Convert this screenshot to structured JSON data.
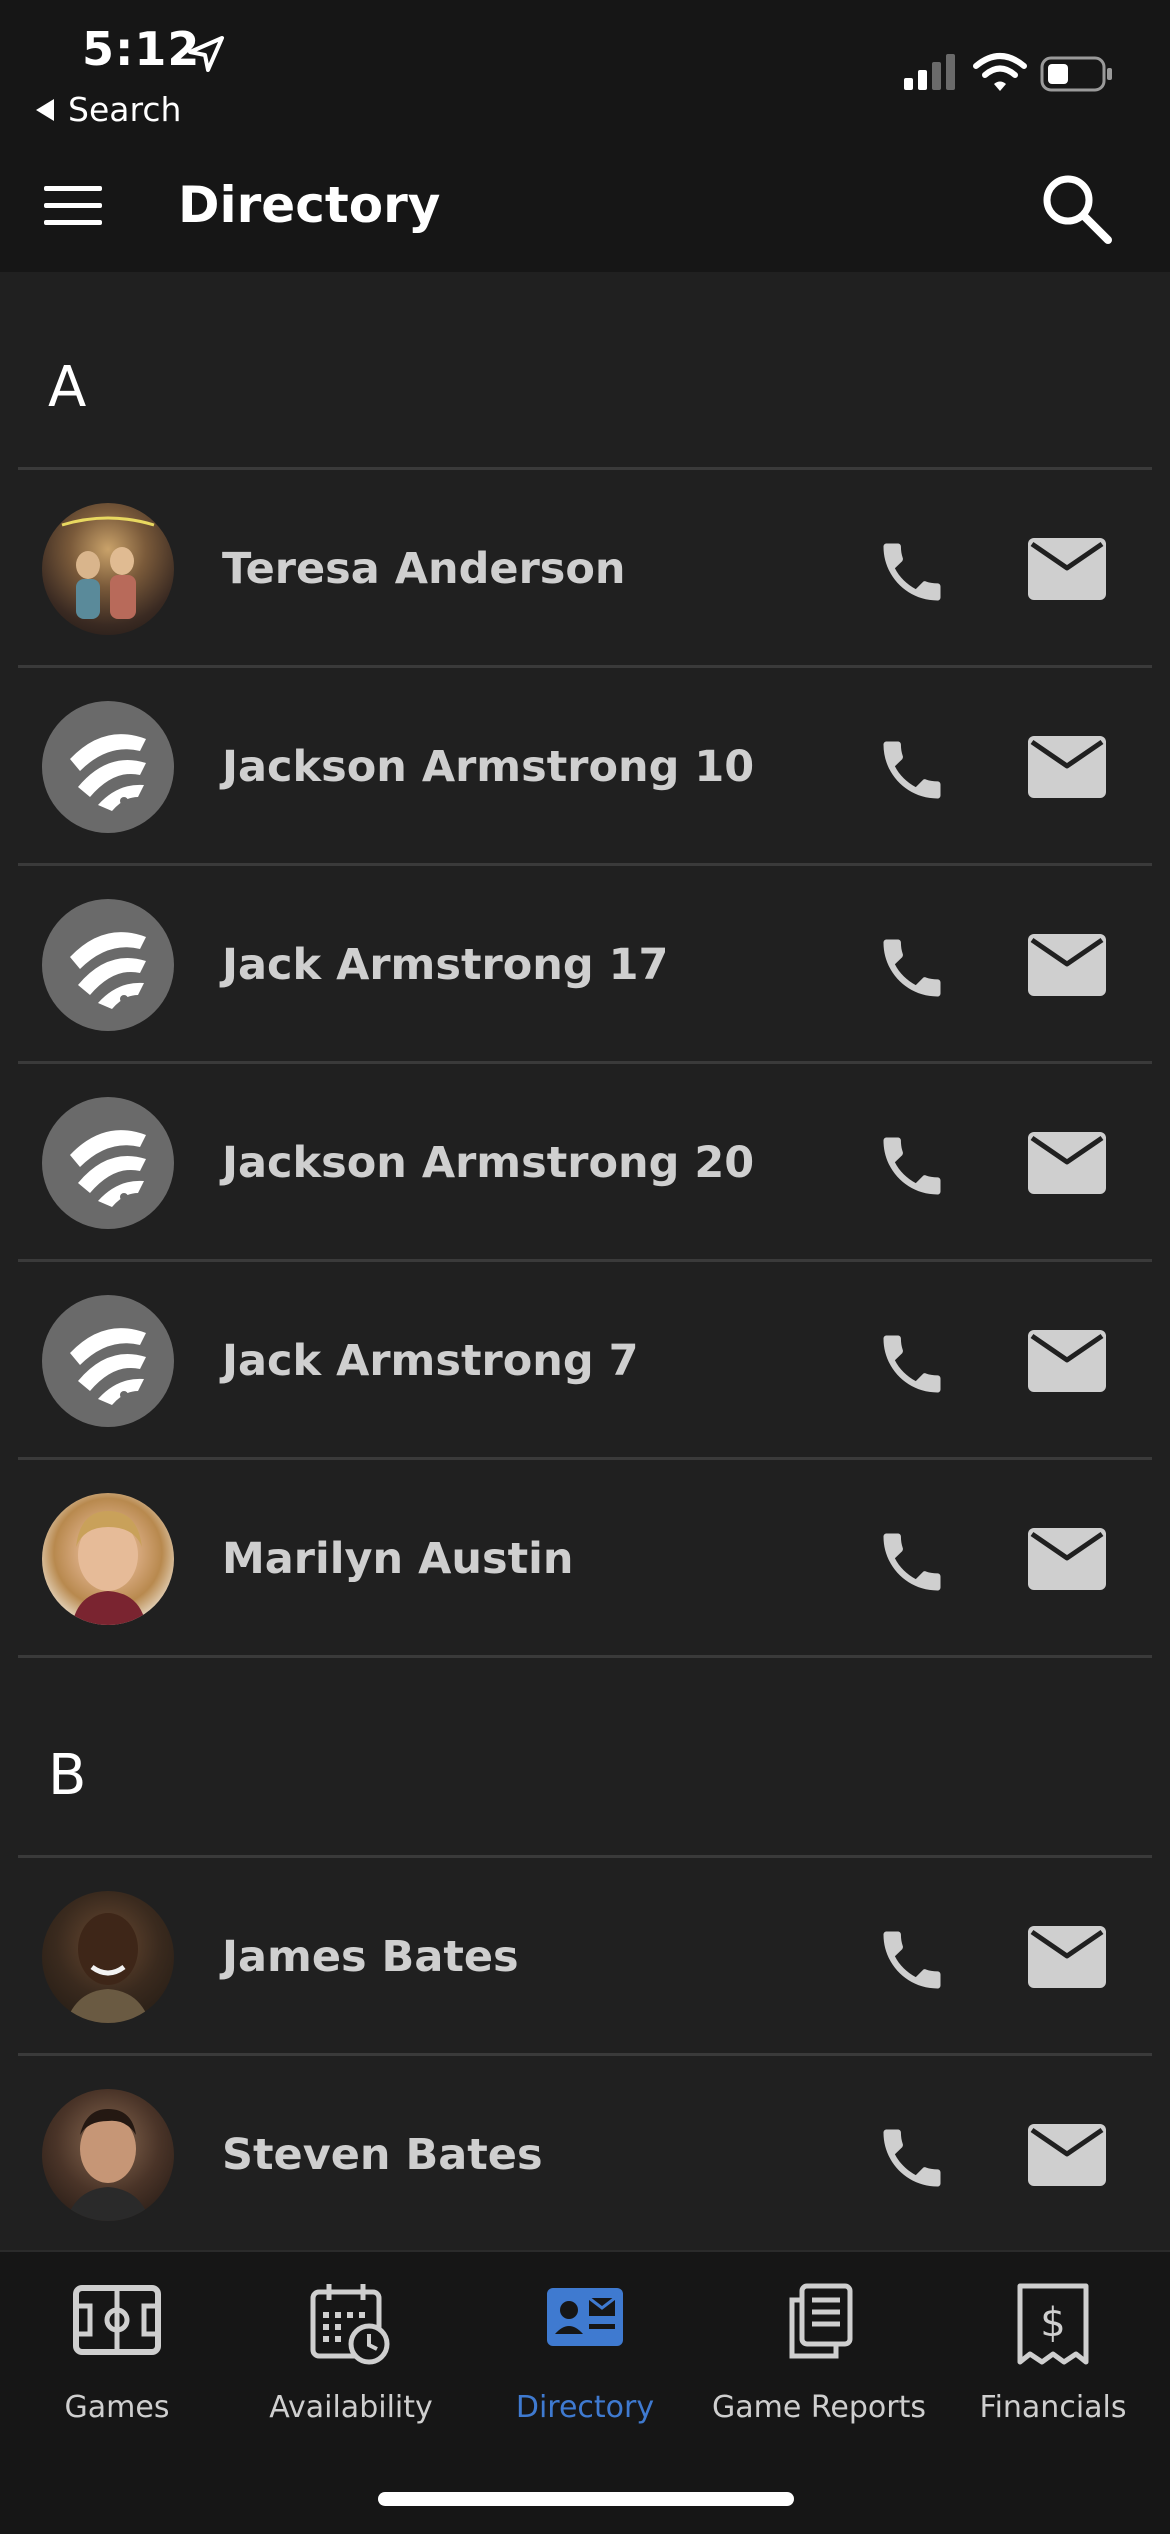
{
  "status_bar": {
    "time": "5:12",
    "back_label": "Search"
  },
  "app_bar": {
    "title": "Directory"
  },
  "sections": [
    {
      "letter": "A",
      "contacts": [
        {
          "name": "Teresa Anderson",
          "avatar": "photo"
        },
        {
          "name": "Jackson Armstrong 10",
          "avatar": "logo"
        },
        {
          "name": "Jack Armstrong 17",
          "avatar": "logo"
        },
        {
          "name": "Jackson Armstrong 20",
          "avatar": "logo"
        },
        {
          "name": "Jack Armstrong 7",
          "avatar": "logo"
        },
        {
          "name": "Marilyn Austin",
          "avatar": "photo"
        }
      ]
    },
    {
      "letter": "B",
      "contacts": [
        {
          "name": "James Bates",
          "avatar": "photo"
        },
        {
          "name": "Steven Bates",
          "avatar": "photo"
        }
      ]
    }
  ],
  "tabs": [
    {
      "label": "Games",
      "icon": "field-icon"
    },
    {
      "label": "Availability",
      "icon": "calendar-clock-icon"
    },
    {
      "label": "Directory",
      "icon": "contact-card-icon",
      "active": true
    },
    {
      "label": "Game Reports",
      "icon": "reports-icon"
    },
    {
      "label": "Financials",
      "icon": "receipt-dollar-icon"
    }
  ],
  "colors": {
    "accent": "#3f7ad0",
    "background": "#202020",
    "bar": "#161616",
    "icon_gray": "#cfcfcf"
  }
}
